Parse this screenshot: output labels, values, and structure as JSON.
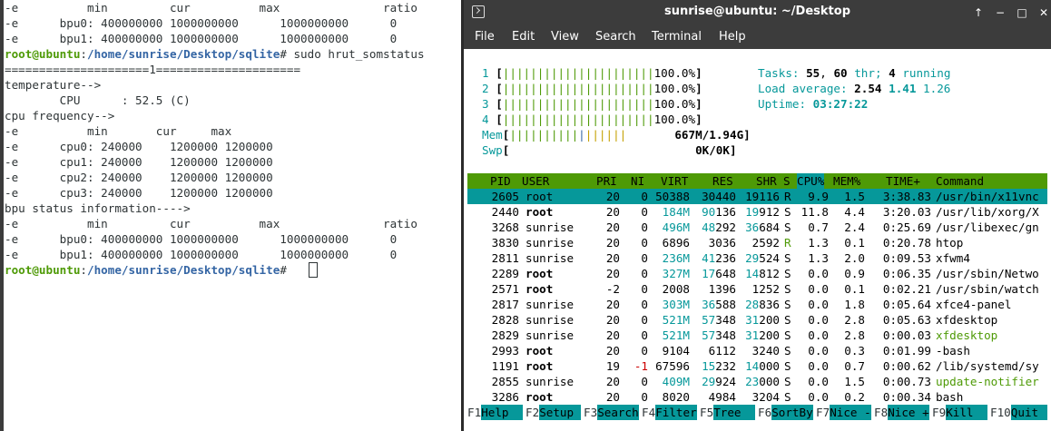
{
  "left_terminal": {
    "lines": [
      {
        "parts": [
          {
            "t": "-e          min         cur          max               ratio",
            "c": ""
          }
        ]
      },
      {
        "parts": [
          {
            "t": "-e      bpu0: 400000000 1000000000      1000000000      0",
            "c": ""
          }
        ]
      },
      {
        "parts": [
          {
            "t": "-e      bpu1: 400000000 1000000000      1000000000      0",
            "c": ""
          }
        ]
      },
      {
        "parts": [
          {
            "t": "root@ubuntu",
            "c": "g"
          },
          {
            "t": ":",
            "c": ""
          },
          {
            "t": "/home/sunrise/Desktop/sqlite",
            "c": "b"
          },
          {
            "t": "# sudo hrut_somstatus",
            "c": ""
          }
        ]
      },
      {
        "parts": [
          {
            "t": "=====================1=====================",
            "c": ""
          }
        ]
      },
      {
        "parts": [
          {
            "t": "temperature-->",
            "c": ""
          }
        ]
      },
      {
        "parts": [
          {
            "t": "        CPU      : 52.5 (C)",
            "c": ""
          }
        ]
      },
      {
        "parts": [
          {
            "t": "cpu frequency-->",
            "c": ""
          }
        ]
      },
      {
        "parts": [
          {
            "t": "-e          min       cur     max",
            "c": ""
          }
        ]
      },
      {
        "parts": [
          {
            "t": "-e      cpu0: 240000    1200000 1200000",
            "c": ""
          }
        ]
      },
      {
        "parts": [
          {
            "t": "-e      cpu1: 240000    1200000 1200000",
            "c": ""
          }
        ]
      },
      {
        "parts": [
          {
            "t": "-e      cpu2: 240000    1200000 1200000",
            "c": ""
          }
        ]
      },
      {
        "parts": [
          {
            "t": "-e      cpu3: 240000    1200000 1200000",
            "c": ""
          }
        ]
      },
      {
        "parts": [
          {
            "t": "bpu status information---->",
            "c": ""
          }
        ]
      },
      {
        "parts": [
          {
            "t": "-e          min         cur          max               ratio",
            "c": ""
          }
        ]
      },
      {
        "parts": [
          {
            "t": "-e      bpu0: 400000000 1000000000      1000000000      0",
            "c": ""
          }
        ]
      },
      {
        "parts": [
          {
            "t": "-e      bpu1: 400000000 1000000000      1000000000      0",
            "c": ""
          }
        ]
      },
      {
        "parts": [
          {
            "t": "root@ubuntu",
            "c": "g"
          },
          {
            "t": ":",
            "c": ""
          },
          {
            "t": "/home/sunrise/Desktop/sqlite",
            "c": "b"
          },
          {
            "t": "# ",
            "c": ""
          }
        ]
      }
    ]
  },
  "window": {
    "title": "sunrise@ubuntu: ~/Desktop",
    "controls": [
      "↑",
      "−",
      "□",
      "✕"
    ],
    "menu": [
      "File",
      "Edit",
      "View",
      "Search",
      "Terminal",
      "Help"
    ]
  },
  "htop": {
    "cpus": [
      {
        "id": "1",
        "bar": "||||||||||||||||||||||",
        "pct": "100.0%"
      },
      {
        "id": "2",
        "bar": "||||||||||||||||||||||",
        "pct": "100.0%"
      },
      {
        "id": "3",
        "bar": "||||||||||||||||||||||",
        "pct": "100.0%"
      },
      {
        "id": "4",
        "bar": "||||||||||||||||||||||",
        "pct": "100.0%"
      }
    ],
    "mem": {
      "label": "Mem",
      "bar_green": "||||||||||",
      "bar_blue": "|",
      "bar_yellow": "||||||",
      "value": "667M/1.94G"
    },
    "swp": {
      "label": "Swp",
      "value": "0K/0K"
    },
    "tasks": {
      "label": "Tasks:",
      "tasks": "55",
      "sep": ",",
      "threads": "60",
      "thr_label": "thr;",
      "running": "4",
      "running_label": "running"
    },
    "load": {
      "label": "Load average:",
      "l1": "2.54",
      "l5": "1.41",
      "l15": "1.26"
    },
    "uptime": {
      "label": "Uptime:",
      "value": "03:27:22"
    },
    "columns": [
      "PID",
      "USER",
      "PRI",
      "NI",
      "VIRT",
      "RES",
      "SHR",
      "S",
      "CPU%",
      "MEM%",
      "TIME+",
      "Command"
    ],
    "processes": [
      {
        "pid": "2605",
        "user": "root",
        "pri": "20",
        "ni": "0",
        "virt": "50388",
        "res": "30440",
        "shr": "19116",
        "s": "R",
        "cpu": "9.9",
        "mem": "1.5",
        "time": "3:38.83",
        "cmd": "/usr/bin/x11vnc",
        "selected": true
      },
      {
        "pid": "2440",
        "user": "root",
        "pri": "20",
        "ni": "0",
        "virt": "184M",
        "res": "90136",
        "shr": "19912",
        "s": "S",
        "cpu": "11.8",
        "mem": "4.4",
        "time": "3:20.03",
        "cmd": "/usr/lib/xorg/X"
      },
      {
        "pid": "3268",
        "user": "sunrise",
        "pri": "20",
        "ni": "0",
        "virt": "496M",
        "res": "48292",
        "shr": "36684",
        "s": "S",
        "cpu": "0.7",
        "mem": "2.4",
        "time": "0:25.69",
        "cmd": "/usr/libexec/gn"
      },
      {
        "pid": "3830",
        "user": "sunrise",
        "pri": "20",
        "ni": "0",
        "virt": "6896",
        "res": "3036",
        "shr": "2592",
        "s": "R",
        "cpu": "1.3",
        "mem": "0.1",
        "time": "0:20.78",
        "cmd": "htop"
      },
      {
        "pid": "2811",
        "user": "sunrise",
        "pri": "20",
        "ni": "0",
        "virt": "236M",
        "res": "41236",
        "shr": "29524",
        "s": "S",
        "cpu": "1.3",
        "mem": "2.0",
        "time": "0:09.53",
        "cmd": "xfwm4"
      },
      {
        "pid": "2289",
        "user": "root",
        "pri": "20",
        "ni": "0",
        "virt": "327M",
        "res": "17648",
        "shr": "14812",
        "s": "S",
        "cpu": "0.0",
        "mem": "0.9",
        "time": "0:06.35",
        "cmd": "/usr/sbin/Netwo"
      },
      {
        "pid": "2571",
        "user": "root",
        "pri": "-2",
        "ni": "0",
        "virt": "2008",
        "res": "1396",
        "shr": "1252",
        "s": "S",
        "cpu": "0.0",
        "mem": "0.1",
        "time": "0:02.21",
        "cmd": "/usr/sbin/watch"
      },
      {
        "pid": "2817",
        "user": "sunrise",
        "pri": "20",
        "ni": "0",
        "virt": "303M",
        "res": "36588",
        "shr": "28836",
        "s": "S",
        "cpu": "0.0",
        "mem": "1.8",
        "time": "0:05.64",
        "cmd": "xfce4-panel"
      },
      {
        "pid": "2828",
        "user": "sunrise",
        "pri": "20",
        "ni": "0",
        "virt": "521M",
        "res": "57348",
        "shr": "31200",
        "s": "S",
        "cpu": "0.0",
        "mem": "2.8",
        "time": "0:05.63",
        "cmd": "xfdesktop"
      },
      {
        "pid": "2829",
        "user": "sunrise",
        "pri": "20",
        "ni": "0",
        "virt": "521M",
        "res": "57348",
        "shr": "31200",
        "s": "S",
        "cpu": "0.0",
        "mem": "2.8",
        "time": "0:00.03",
        "cmd": "xfdesktop",
        "thread": true
      },
      {
        "pid": "2993",
        "user": "root",
        "pri": "20",
        "ni": "0",
        "virt": "9104",
        "res": "6112",
        "shr": "3240",
        "s": "S",
        "cpu": "0.0",
        "mem": "0.3",
        "time": "0:01.99",
        "cmd": "-bash"
      },
      {
        "pid": "1191",
        "user": "root",
        "pri": "19",
        "ni": "-1",
        "virt": "67596",
        "res": "15232",
        "shr": "14000",
        "s": "S",
        "cpu": "0.0",
        "mem": "0.7",
        "time": "0:00.62",
        "cmd": "/lib/systemd/sy"
      },
      {
        "pid": "2855",
        "user": "sunrise",
        "pri": "20",
        "ni": "0",
        "virt": "409M",
        "res": "29924",
        "shr": "23000",
        "s": "S",
        "cpu": "0.0",
        "mem": "1.5",
        "time": "0:00.73",
        "cmd": "update-notifier",
        "thread": true
      },
      {
        "pid": "3286",
        "user": "root",
        "pri": "20",
        "ni": "0",
        "virt": "8020",
        "res": "4984",
        "shr": "3204",
        "s": "S",
        "cpu": "0.0",
        "mem": "0.2",
        "time": "0:00.34",
        "cmd": "bash"
      }
    ],
    "fkeys": [
      {
        "k": "F1",
        "l": "Help  "
      },
      {
        "k": "F2",
        "l": "Setup "
      },
      {
        "k": "F3",
        "l": "Search"
      },
      {
        "k": "F4",
        "l": "Filter"
      },
      {
        "k": "F5",
        "l": "Tree  "
      },
      {
        "k": "F6",
        "l": "SortBy"
      },
      {
        "k": "F7",
        "l": "Nice -"
      },
      {
        "k": "F8",
        "l": "Nice +"
      },
      {
        "k": "F9",
        "l": "Kill  "
      },
      {
        "k": "F10",
        "l": "Quit  "
      }
    ]
  },
  "colors": {
    "green": "#4e9a06",
    "cyan": "#06989a",
    "blue": "#3465a4",
    "yellow": "#c4a000",
    "red": "#cc0000",
    "titlebar": "#3c3c3c"
  }
}
